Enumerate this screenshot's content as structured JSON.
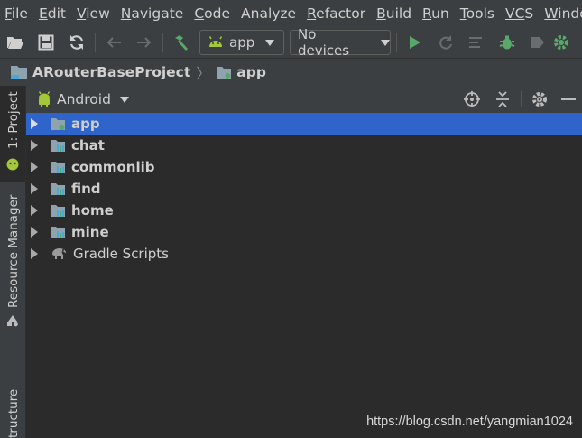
{
  "menu": [
    {
      "u": "F",
      "rest": "ile"
    },
    {
      "u": "E",
      "rest": "dit"
    },
    {
      "u": "V",
      "rest": "iew"
    },
    {
      "u": "N",
      "rest": "avigate"
    },
    {
      "u": "C",
      "rest": "ode"
    },
    {
      "u": "",
      "rest": "Analyze"
    },
    {
      "u": "R",
      "rest": "efactor"
    },
    {
      "u": "B",
      "rest": "uild"
    },
    {
      "u": "R",
      "rest": "un"
    },
    {
      "u": "T",
      "rest": "ools"
    },
    {
      "u": "VC",
      "rest": "S"
    },
    {
      "u": "W",
      "rest": "indow"
    }
  ],
  "toolbar": {
    "run_config": "app",
    "device": "No devices"
  },
  "breadcrumb": {
    "project": "ARouterBaseProject",
    "module": "app"
  },
  "left_strip": {
    "project_tab": "1: Project",
    "resource_tab": "Resource Manager",
    "structure_tab": "tructure"
  },
  "panel": {
    "view_mode": "Android"
  },
  "tree": [
    {
      "label": "app",
      "bold": true,
      "selected": true,
      "icon": "app-module-icon"
    },
    {
      "label": "chat",
      "bold": true,
      "selected": false,
      "icon": "library-module-icon"
    },
    {
      "label": "commonlib",
      "bold": true,
      "selected": false,
      "icon": "library-module-icon"
    },
    {
      "label": "find",
      "bold": true,
      "selected": false,
      "icon": "library-module-icon"
    },
    {
      "label": "home",
      "bold": true,
      "selected": false,
      "icon": "library-module-icon"
    },
    {
      "label": "mine",
      "bold": true,
      "selected": false,
      "icon": "library-module-icon"
    },
    {
      "label": "Gradle Scripts",
      "bold": false,
      "selected": false,
      "icon": "gradle-elephant-icon"
    }
  ],
  "watermark": "https://blog.csdn.net/yangmian1024",
  "colors": {
    "selection": "#2f65ca",
    "android_green": "#a4c639",
    "run_green": "#59a869",
    "folder": "#8fa3ae"
  }
}
